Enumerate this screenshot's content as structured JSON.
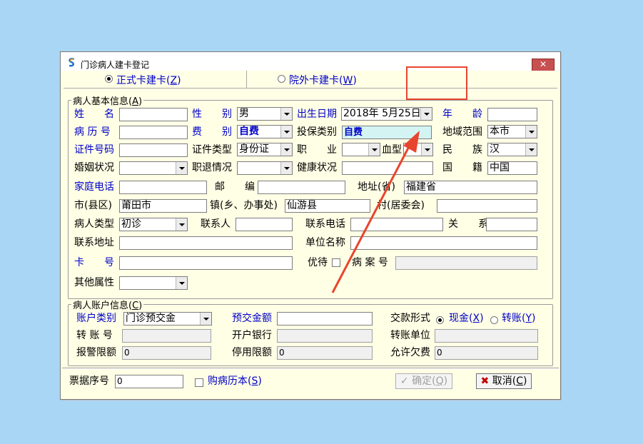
{
  "window": {
    "title": "门诊病人建卡登记",
    "close_glyph": "✕"
  },
  "tabs": [
    {
      "label": "正式卡建卡",
      "key": "Z",
      "selected": true
    },
    {
      "label": "院外卡建卡",
      "key": "W",
      "selected": false
    }
  ],
  "basic": {
    "legend": "病人基本信息",
    "legend_key": "A",
    "name_label": "姓　　名",
    "name_value": "",
    "sex_label": "性　　别",
    "sex_value": "男",
    "birth_label": "出生日期",
    "birth_value": "2018年 5月25日",
    "age_label": "年　　龄",
    "age_value": "",
    "record_label": "病 历 号",
    "record_value": "",
    "fee_label": "费　　别",
    "fee_value": "自费",
    "insure_label": "投保类别",
    "insure_value": "自费",
    "region_label": "地域范围",
    "region_value": "本市",
    "cert_no_label": "证件号码",
    "cert_no_value": "",
    "cert_type_label": "证件类型",
    "cert_type_value": "身份证",
    "job_label": "职　　业",
    "job_value": "",
    "blood_label": "血型",
    "blood_value": "",
    "nation_label": "民　　族",
    "nation_value": "汉",
    "marital_label": "婚姻状况",
    "marital_value": "",
    "retire_label": "职退情况",
    "retire_value": "",
    "health_label": "健康状况",
    "health_value": "",
    "country_label": "国　　籍",
    "country_value": "中国",
    "home_phone_label": "家庭电话",
    "home_phone_value": "",
    "postcode_label": "邮　　编",
    "postcode_value": "",
    "province_label": "地址(省)",
    "province_value": "福建省",
    "city_label": "市(县区)",
    "city_value": "莆田市",
    "town_label": "镇(乡、办事处)",
    "town_value": "仙游县",
    "village_label": "村(居委会)",
    "village_value": "",
    "ptype_label": "病人类型",
    "ptype_value": "初诊",
    "contact_label": "联系人",
    "contact_value": "",
    "contact_phone_label": "联系电话",
    "contact_phone_value": "",
    "relation_label": "关　　系",
    "relation_value": "",
    "address_label": "联系地址",
    "address_value": "",
    "unit_label": "单位名称",
    "unit_value": "",
    "card_label": "卡　　号",
    "card_value": "",
    "vip_label": "优待",
    "vip_checked": false,
    "case_label": "病 案 号",
    "case_value": "",
    "other_label": "其他属性",
    "other_value": ""
  },
  "account": {
    "legend": "病人账户信息",
    "legend_key": "C",
    "acct_type_label": "账户类别",
    "acct_type_value": "门诊预交金",
    "prepay_label": "预交金额",
    "prepay_value": "",
    "pay_form_label": "交款形式",
    "pay_cash_label": "现金",
    "pay_cash_key": "X",
    "pay_transfer_label": "转账",
    "pay_transfer_key": "Y",
    "pay_selected": "现金",
    "transfer_no_label": "转 账 号",
    "transfer_no_value": "",
    "bank_label": "开户银行",
    "bank_value": "",
    "transfer_unit_label": "转账单位",
    "transfer_unit_value": "",
    "alarm_label": "报警限额",
    "alarm_value": "0",
    "stop_label": "停用限额",
    "stop_value": "0",
    "owe_label": "允许欠费",
    "owe_value": "0"
  },
  "footer": {
    "receipt_label": "票据序号",
    "receipt_value": "0",
    "buy_book_label": "购病历本",
    "buy_book_key": "S",
    "buy_book_checked": false,
    "ok_label": "确定",
    "ok_key": "Q",
    "cancel_label": "取消",
    "cancel_key": "C"
  },
  "colors": {
    "desktop": "#a9d6f4",
    "client_bg": "#ffffe6",
    "label_blue": "#0000c8",
    "annotation_red": "#e8452e",
    "highlight_field": "#d4f4f4"
  }
}
